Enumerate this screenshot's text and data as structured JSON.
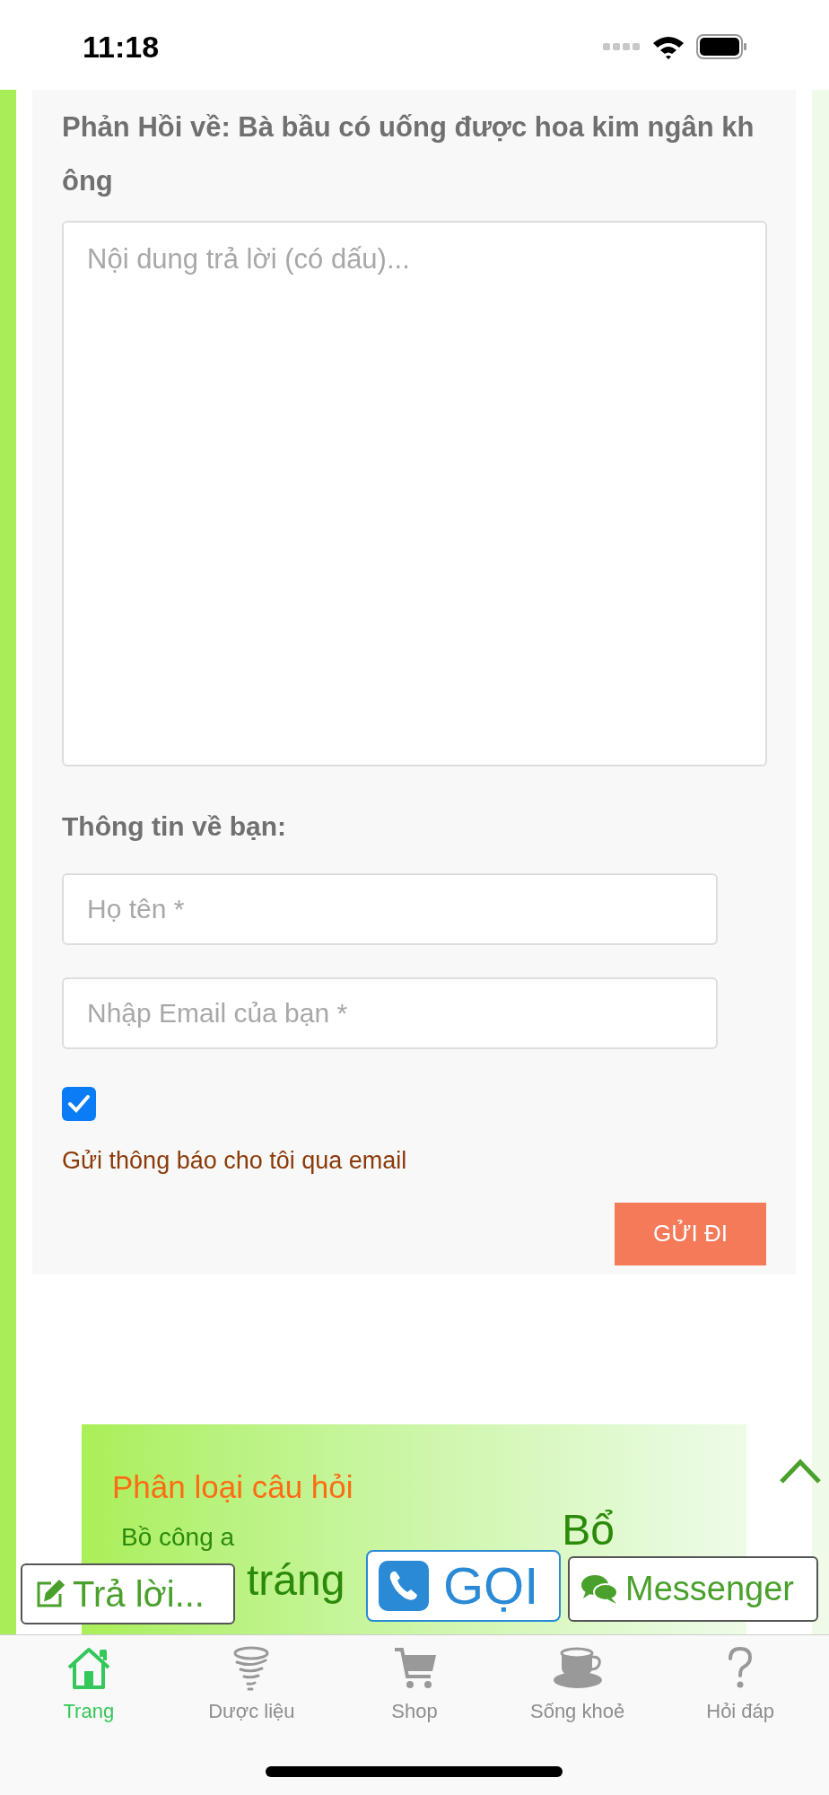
{
  "status_bar": {
    "time": "11:18"
  },
  "reply_form": {
    "heading": "Phản Hồi về: Bà bầu có uống được hoa kim ngân không",
    "message": {
      "placeholder": "Nội dung trả lời (có dấu)..."
    },
    "about_label": "Thông tin về bạn:",
    "name": {
      "placeholder": "Họ tên *"
    },
    "email": {
      "placeholder": "Nhập Email của bạn *"
    },
    "notify": {
      "checked": true,
      "label": "Gửi thông báo cho tôi qua email"
    },
    "submit": "GỬI ĐI"
  },
  "categories": {
    "title": "Phân loại câu hỏi",
    "links": [
      {
        "label": "Bồ công a",
        "kind": "small"
      },
      {
        "label": "Bổ",
        "kind": "large"
      },
      {
        "label": "tráng",
        "kind": "large"
      }
    ]
  },
  "floating_buttons": [
    {
      "label": "Trả lời...",
      "kind": "reply"
    },
    {
      "label": "GỌI",
      "kind": "call"
    },
    {
      "label": "Messenger",
      "kind": "messenger"
    }
  ],
  "tab_bar": [
    {
      "label": "Trang",
      "kind": "home",
      "selected": true
    },
    {
      "label": "Dược liệu",
      "kind": "herb",
      "selected": false
    },
    {
      "label": "Shop",
      "kind": "cart",
      "selected": false
    },
    {
      "label": "Sống khoẻ",
      "kind": "cup",
      "selected": false
    },
    {
      "label": "Hỏi đáp",
      "kind": "help",
      "selected": false
    }
  ]
}
